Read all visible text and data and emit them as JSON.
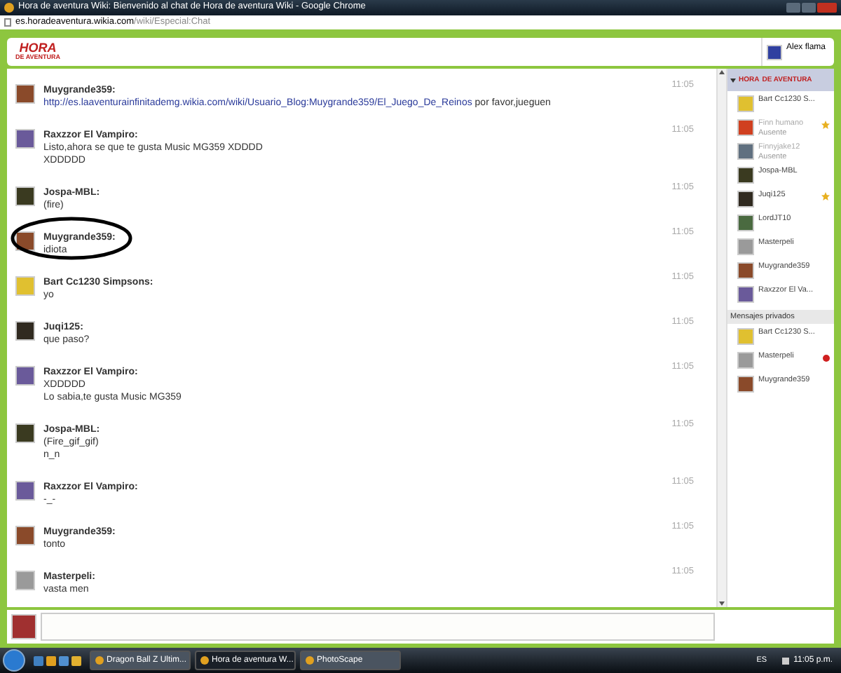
{
  "window": {
    "title": "Hora de aventura Wiki: Bienvenido al chat de Hora de aventura Wiki - Google Chrome"
  },
  "address_bar": {
    "host": "es.horadeaventura.wikia.com",
    "path": "/wiki/Especial:Chat"
  },
  "header": {
    "logo_top": "HORA",
    "logo_bottom": "DE AVENTURA",
    "user": "Alex flama"
  },
  "room": {
    "logo_top": "HORA",
    "logo_bottom": "DE AVENTURA"
  },
  "messages": [
    {
      "author": "Muygrande359:",
      "lines": [
        "http://es.laaventurainfinitademg.wikia.com/wiki/Usuario_Blog:Muygrande359/El_Juego_De_Reinos"
      ],
      "link_suffix": " por favor,jueguen",
      "time": "11:05",
      "circled": false,
      "color": "#8a4a2a"
    },
    {
      "author": "Raxzzor El Vampiro:",
      "lines": [
        "Listo,ahora se que te gusta Music MG359 XDDDD",
        "XDDDDD"
      ],
      "time": "11:05",
      "circled": false,
      "color": "#6a5a9a"
    },
    {
      "author": "Jospa-MBL:",
      "lines": [
        "(fire)"
      ],
      "time": "11:05",
      "circled": false,
      "color": "#3a3a20"
    },
    {
      "author": "Muygrande359:",
      "lines": [
        "idiota"
      ],
      "time": "11:05",
      "circled": true,
      "color": "#8a4a2a"
    },
    {
      "author": "Bart Cc1230 Simpsons:",
      "lines": [
        "yo"
      ],
      "time": "11:05",
      "circled": false,
      "color": "#e0c030"
    },
    {
      "author": "Juqi125:",
      "lines": [
        "que paso?"
      ],
      "time": "11:05",
      "circled": false,
      "color": "#302a20"
    },
    {
      "author": "Raxzzor El Vampiro:",
      "lines": [
        "XDDDDD",
        "Lo sabia,te gusta Music MG359"
      ],
      "time": "11:05",
      "circled": false,
      "color": "#6a5a9a"
    },
    {
      "author": "Jospa-MBL:",
      "lines": [
        "(Fire_gif_gif)",
        "n_n"
      ],
      "time": "11:05",
      "circled": false,
      "color": "#3a3a20"
    },
    {
      "author": "Raxzzor El Vampiro:",
      "lines": [
        "-_-"
      ],
      "time": "11:05",
      "circled": false,
      "color": "#6a5a9a"
    },
    {
      "author": "Muygrande359:",
      "lines": [
        "tonto"
      ],
      "time": "11:05",
      "circled": false,
      "color": "#8a4a2a"
    },
    {
      "author": "Masterpeli:",
      "lines": [
        "vasta men"
      ],
      "time": "11:05",
      "circled": false,
      "color": "#9a9a9a"
    }
  ],
  "users": [
    {
      "name": "Bart Cc1230 S...",
      "away": false,
      "starred": false,
      "color": "#e0c030"
    },
    {
      "name": "Finn humano",
      "status": "Ausente",
      "away": true,
      "starred": true,
      "color": "#d04020"
    },
    {
      "name": "Finnyjake12",
      "status": "Ausente",
      "away": true,
      "starred": false,
      "color": "#607080"
    },
    {
      "name": "Jospa-MBL",
      "away": false,
      "starred": false,
      "color": "#3a3a20"
    },
    {
      "name": "Juqi125",
      "away": false,
      "starred": true,
      "color": "#302a20"
    },
    {
      "name": "LordJT10",
      "away": false,
      "starred": false,
      "color": "#4a6a40"
    },
    {
      "name": "Masterpeli",
      "away": false,
      "starred": false,
      "color": "#9a9a9a"
    },
    {
      "name": "Muygrande359",
      "away": false,
      "starred": false,
      "color": "#8a4a2a"
    },
    {
      "name": "Raxzzor El Va...",
      "away": false,
      "starred": false,
      "color": "#6a5a9a"
    }
  ],
  "private": {
    "title": "Mensajes privados",
    "users": [
      {
        "name": "Bart Cc1230 S...",
        "unread": false,
        "color": "#e0c030"
      },
      {
        "name": "Masterpeli",
        "unread": true,
        "color": "#9a9a9a"
      },
      {
        "name": "Muygrande359",
        "unread": false,
        "color": "#8a4a2a"
      }
    ]
  },
  "taskbar": {
    "tasks": [
      {
        "label": "Dragon Ball Z Ultim...",
        "selected": false
      },
      {
        "label": "Hora de aventura W...",
        "selected": true
      },
      {
        "label": "PhotoScape",
        "selected": false
      }
    ],
    "language": "ES",
    "clock": "11:05 p.m."
  }
}
